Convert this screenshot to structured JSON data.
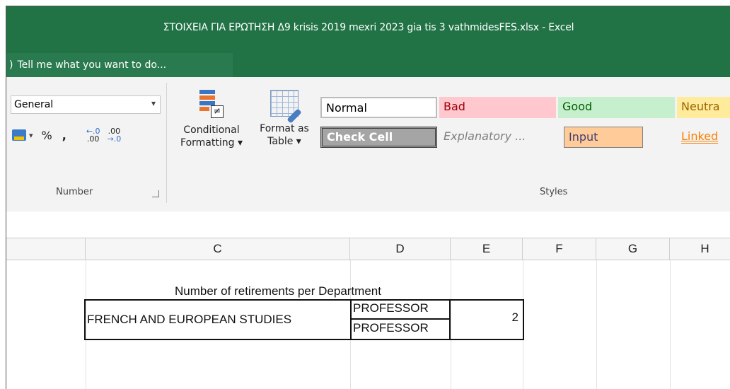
{
  "window": {
    "title": "ΣΤΟΙΧΕΙΑ ΓΙΑ ΕΡΩΤΗΣΗ Δ9 krisis 2019 mexri 2023 gia tis 3 vathmidesFES.xlsx - Excel",
    "tell_me": "Tell me what you want to do..."
  },
  "ribbon": {
    "number": {
      "format_value": "General",
      "percent": "%",
      "comma": ",",
      "inc_decimal_top": "←.0",
      "inc_decimal_bottom": ".00",
      "dec_decimal_top": ".00",
      "dec_decimal_bottom": "→.0",
      "group_label": "Number"
    },
    "conditional_formatting": {
      "line1": "Conditional",
      "line2": "Formatting ▾"
    },
    "format_as_table": {
      "line1": "Format as",
      "line2": "Table ▾"
    },
    "styles": {
      "group_label": "Styles",
      "normal": "Normal",
      "bad": "Bad",
      "good": "Good",
      "neutral": "Neutra",
      "check_cell": "Check Cell",
      "explanatory": "Explanatory ...",
      "input": "Input",
      "linked": "Linked"
    }
  },
  "sheet": {
    "columns": [
      "C",
      "D",
      "E",
      "F",
      "G",
      "H"
    ],
    "caption": "Number of retirements per Department",
    "department": "FRENCH AND EUROPEAN STUDIES",
    "rank1": "PROFESSOR",
    "rank2": "PROFESSOR",
    "count": "2"
  },
  "colors": {
    "excel_green": "#217346",
    "bad_fill": "#ffc7ce",
    "bad_text": "#9c0006",
    "good_fill": "#c6efce",
    "good_text": "#006100",
    "neutral_fill": "#ffeb9c",
    "neutral_text": "#9c6500",
    "input_fill": "#ffcc99",
    "check_fill": "#a5a5a5"
  }
}
